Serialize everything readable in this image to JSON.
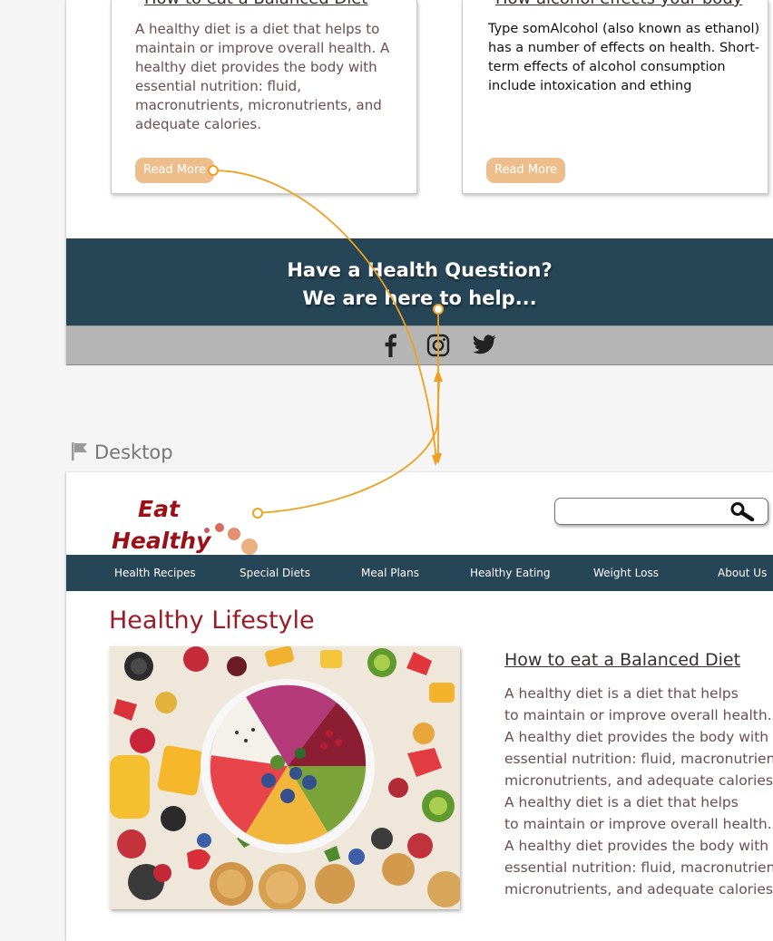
{
  "top_preview": {
    "cards": [
      {
        "title": "How to eat a Balanced Diet",
        "text": "A healthy diet is a diet that helps to maintain or improve overall health. A healthy diet provides the body with essential nutrition: fluid, macronutrients, micronutrients, and adequate calories.",
        "button": "Read More"
      },
      {
        "title": "How alcohol effects your body",
        "text": "Type somAlcohol (also known as ethanol) has a number of effects on health. Short-term effects of alcohol consumption include intoxication and ething",
        "button": "Read More"
      }
    ],
    "banner": {
      "line1": "Have a Health Question?",
      "line2": "We are here to help..."
    },
    "social": [
      "facebook-icon",
      "instagram-icon",
      "twitter-icon"
    ]
  },
  "artboard": {
    "label": "Desktop"
  },
  "desktop": {
    "logo": {
      "line1": "Eat",
      "line2": "Healthy"
    },
    "search": {
      "placeholder": "",
      "value": ""
    },
    "nav": [
      "Health Recipes",
      "Special Diets",
      "Meal Plans",
      "Healthy Eating",
      "Weight Loss",
      "About Us"
    ],
    "heading": "Healthy Lifestyle",
    "article": {
      "title": "How to eat a Balanced Diet",
      "lines": [
        "A healthy diet is a diet that helps",
        "to maintain or improve overall health.",
        "A healthy diet provides the body with",
        "essential nutrition: fluid, macronutrients,",
        "micronutrients, and adequate calories.",
        "A healthy diet is a diet that helps",
        "to maintain or improve overall health.",
        "A healthy diet provides the body with",
        "essential nutrition: fluid, macronutrients,",
        "micronutrients, and adequate calories."
      ]
    }
  },
  "colors": {
    "brand_red": "#9b0f17",
    "nav_blue": "#264557",
    "button_peach": "#eebd8c",
    "connector_orange": "#f0a020"
  }
}
